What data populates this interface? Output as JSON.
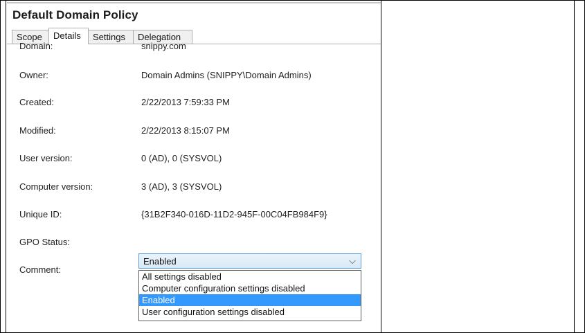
{
  "window": {
    "title": "Default Domain Policy"
  },
  "tabs": [
    {
      "label": "Scope",
      "active": false
    },
    {
      "label": "Details",
      "active": true
    },
    {
      "label": "Settings",
      "active": false
    },
    {
      "label": "Delegation",
      "active": false
    }
  ],
  "details": {
    "domain_label": "Domain:",
    "domain_value": "snippy.com",
    "owner_label": "Owner:",
    "owner_value": "Domain Admins (SNIPPY\\Domain Admins)",
    "created_label": "Created:",
    "created_value": "2/22/2013 7:59:33 PM",
    "modified_label": "Modified:",
    "modified_value": "2/22/2013 8:15:07 PM",
    "user_version_label": "User version:",
    "user_version_value": "0 (AD), 0 (SYSVOL)",
    "computer_version_label": "Computer version:",
    "computer_version_value": "3 (AD), 3 (SYSVOL)",
    "unique_id_label": "Unique ID:",
    "unique_id_value": "{31B2F340-016D-11D2-945F-00C04FB984F9}",
    "gpo_status_label": "GPO Status:",
    "comment_label": "Comment:"
  },
  "gpo_status": {
    "selected": "Enabled",
    "options": [
      "All settings disabled",
      "Computer configuration settings disabled",
      "Enabled",
      "User configuration settings disabled"
    ],
    "highlighted_index": 2
  },
  "icons": {
    "dropdown": "chevron-down-icon"
  },
  "colors": {
    "selection": "#3399ff",
    "dropdown_border": "#5a9bd5"
  }
}
